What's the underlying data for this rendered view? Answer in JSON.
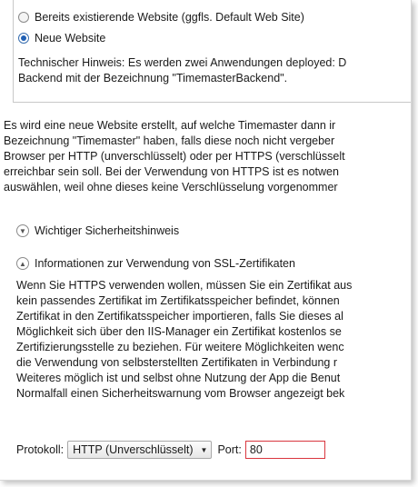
{
  "options": {
    "existing_label": "Bereits existierende Website (ggfls. Default Web Site)",
    "new_label": "Neue Website"
  },
  "tech_note": [
    "Technischer Hinweis: Es werden zwei Anwendungen deployed: D",
    "Backend mit der Bezeichnung \"TimemasterBackend\"."
  ],
  "description": [
    "Es wird eine neue Website erstellt, auf welche Timemaster dann ir",
    "Bezeichnung \"Timemaster\" haben, falls diese noch nicht vergeber",
    "Browser per HTTP (unverschlüsselt) oder per HTTPS (verschlüsselt",
    "erreichbar sein soll. Bei der Verwendung von HTTPS ist es notwen",
    "auswählen, weil ohne dieses keine Verschlüsselung vorgenommer"
  ],
  "expanders": {
    "security_label": "Wichtiger Sicherheitshinweis",
    "ssl_label": "Informationen zur Verwendung von SSL-Zertifikaten"
  },
  "ssl_text": [
    "Wenn Sie HTTPS verwenden wollen, müssen Sie ein Zertifikat aus",
    "kein passendes Zertifikat im Zertifikatsspeicher befindet, können",
    "Zertifikat in den Zertifikatsspeicher importieren, falls Sie dieses al",
    "Möglichkeit sich über den IIS-Manager ein Zertifikat kostenlos se",
    "Zertifizierungsstelle zu beziehen. Für weitere Möglichkeiten wenc",
    "die Verwendung von selbsterstellten Zertifikaten in Verbindung r",
    "Weiteres möglich ist und selbst ohne Nutzung der App die Benut",
    "Normalfall einen Sicherheitswarnung vom Browser angezeigt bek"
  ],
  "protocol": {
    "label": "Protokoll:",
    "selected": "HTTP (Unverschlüsselt)",
    "port_label": "Port:",
    "port_value": "80"
  },
  "colors": {
    "error_border": "#d9363e",
    "radio_accent": "#1f5fb4"
  }
}
